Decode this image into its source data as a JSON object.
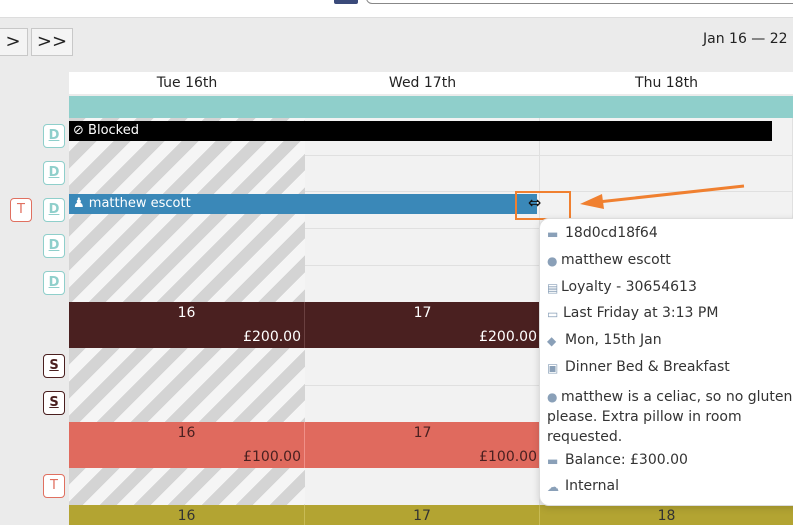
{
  "nav": {
    "next_label": ">",
    "fast_next_label": ">>"
  },
  "date_range": "Jan 16 — 22",
  "days": [
    "Tue 16th",
    "Wed 17th",
    "Thu 18th"
  ],
  "row_badges": [
    "D",
    "D",
    "T",
    "D",
    "D",
    "D",
    "S",
    "S",
    "T"
  ],
  "blocked_label": "Blocked",
  "booking_guest": "matthew escott",
  "rate_rows": [
    {
      "color": "#4a2020",
      "cells": [
        {
          "num": "16",
          "price": "£200.00"
        },
        {
          "num": "17",
          "price": "£200.00"
        }
      ]
    },
    {
      "color": "#e06a5e",
      "cells": [
        {
          "num": "16",
          "price": "£100.00"
        },
        {
          "num": "17",
          "price": "£100.00"
        }
      ]
    },
    {
      "color": "#b3a432",
      "cells": [
        {
          "num": "16"
        },
        {
          "num": "17"
        },
        {
          "num": "18"
        }
      ]
    }
  ],
  "tooltip": {
    "booking_ref": "18d0cd18f64",
    "guest_name": "matthew escott",
    "loyalty": "Loyalty - 30654613",
    "created": "Last Friday at 3:13 PM",
    "arrival": "Mon, 15th Jan",
    "rate_plan": "Dinner Bed & Breakfast",
    "comment": "matthew is a celiac, so no gluten please. Extra pillow in room requested.",
    "balance": "Balance: £300.00",
    "source": "Internal"
  },
  "colors": {
    "teal": "#8fcfcb",
    "booking_blue": "#3a88b8",
    "highlight_orange": "#f08030"
  }
}
